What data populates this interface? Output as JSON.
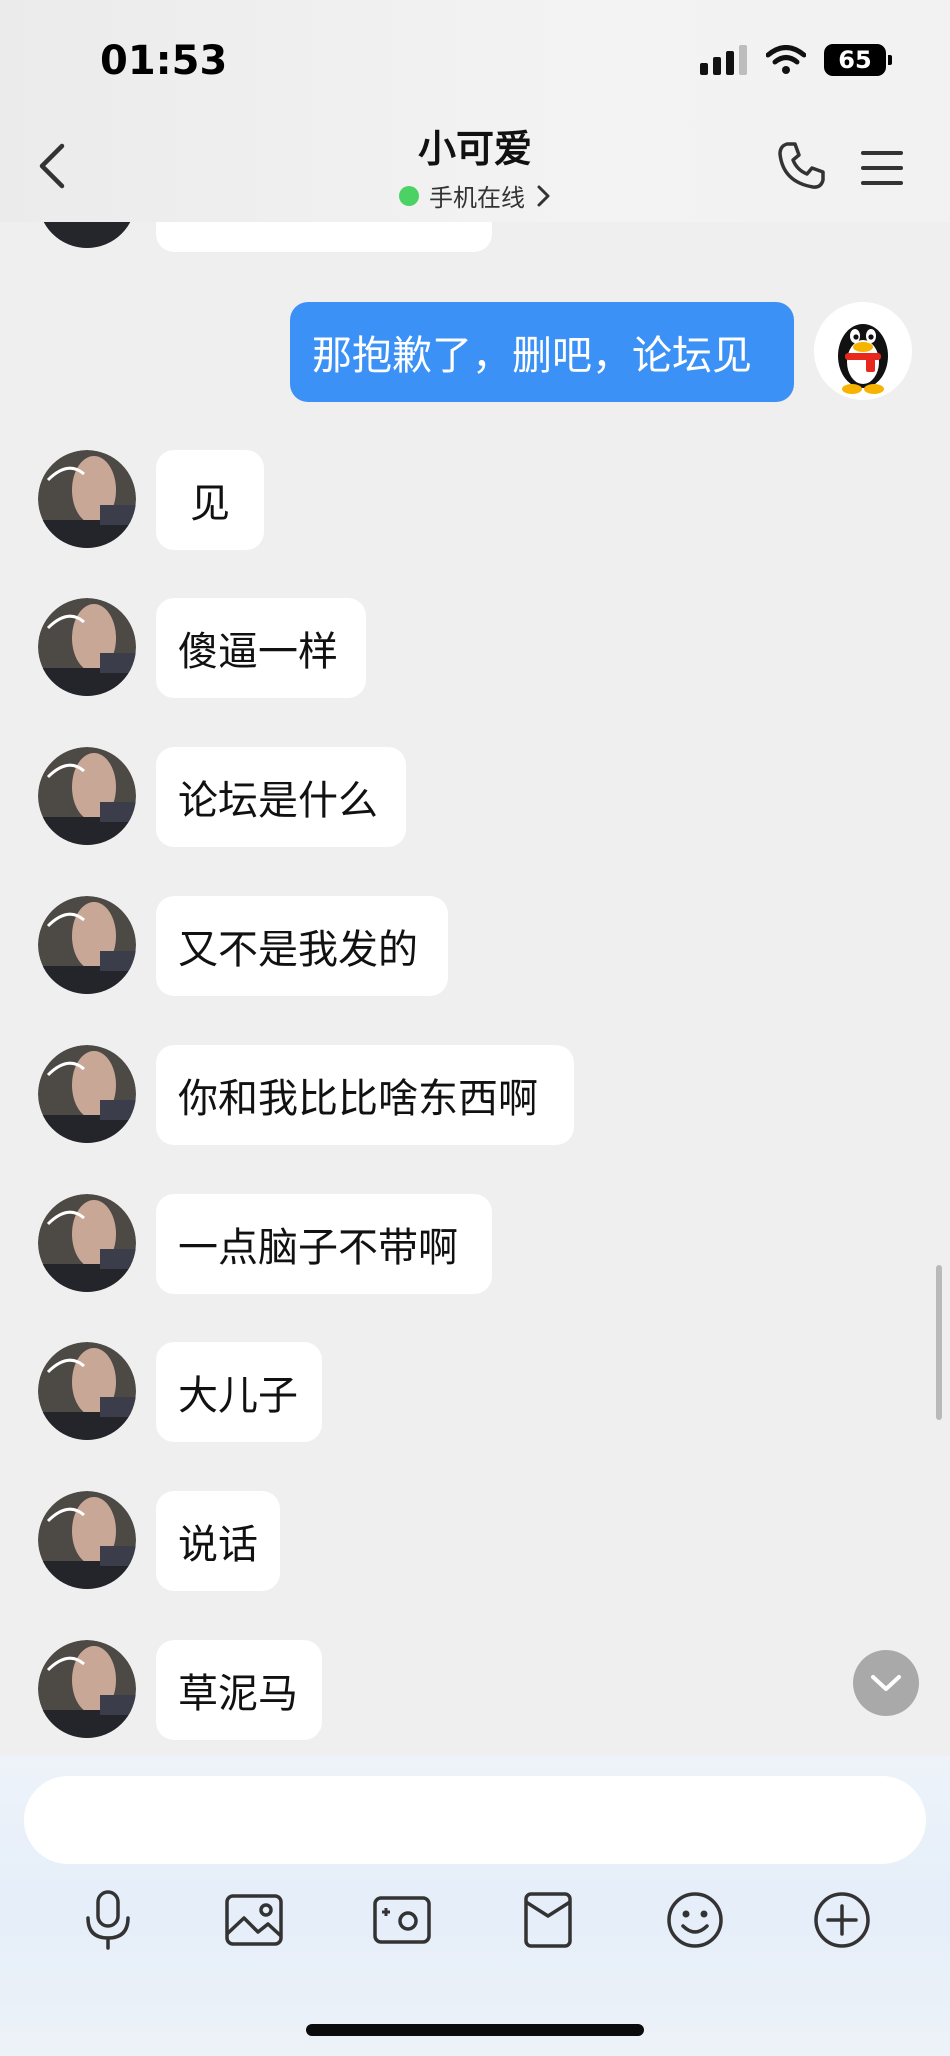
{
  "status_bar": {
    "time": "01:53",
    "battery": "65"
  },
  "header": {
    "title": "小可爱",
    "status_text": "手机在线",
    "status_color": "#4cd264"
  },
  "messages": [
    {
      "sender": "self",
      "text": "那抱歉了，删吧，论坛见"
    },
    {
      "sender": "other",
      "text": "见"
    },
    {
      "sender": "other",
      "text": "傻逼一样"
    },
    {
      "sender": "other",
      "text": "论坛是什么"
    },
    {
      "sender": "other",
      "text": "又不是我发的"
    },
    {
      "sender": "other",
      "text": "你和我比比啥东西啊"
    },
    {
      "sender": "other",
      "text": "一点脑子不带啊"
    },
    {
      "sender": "other",
      "text": "大儿子"
    },
    {
      "sender": "other",
      "text": "说话"
    },
    {
      "sender": "other",
      "text": "草泥马"
    }
  ],
  "input": {
    "placeholder": ""
  },
  "toolbar": [
    {
      "icon": "microphone-icon"
    },
    {
      "icon": "image-icon"
    },
    {
      "icon": "camera-icon"
    },
    {
      "icon": "red-packet-icon"
    },
    {
      "icon": "emoji-icon"
    },
    {
      "icon": "plus-icon"
    }
  ],
  "colors": {
    "self_bubble": "#3b91f6",
    "other_bubble": "#ffffff",
    "background": "#efefef"
  }
}
